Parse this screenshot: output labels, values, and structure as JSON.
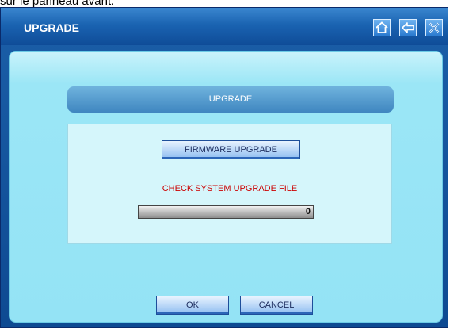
{
  "top_caption": "sur le panneau avant.",
  "window": {
    "title": "UPGRADE",
    "buttons": [
      {
        "icon": "home-icon"
      },
      {
        "icon": "back-arrow-icon"
      },
      {
        "icon": "close-icon"
      }
    ]
  },
  "main": {
    "header_label": "UPGRADE",
    "firmware_button_label": "FIRMWARE UPGRADE",
    "status_text": "CHECK SYSTEM UPGRADE FILE",
    "progress": {
      "percent": 0,
      "label": "0"
    }
  },
  "footer": {
    "ok_label": "OK",
    "cancel_label": "CANCEL"
  },
  "colors": {
    "titlebar": "#1a63b1",
    "content_bg": "#9be6f6",
    "status_text": "#cc0000"
  }
}
